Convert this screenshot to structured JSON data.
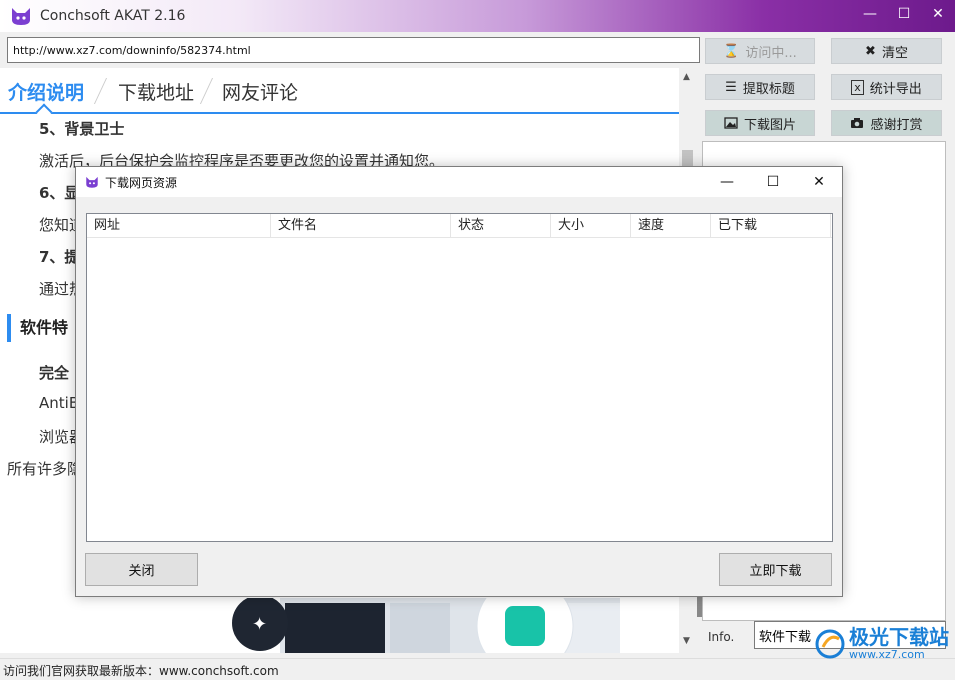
{
  "window": {
    "title": "Conchsoft AKAT 2.16"
  },
  "url_bar": {
    "value": "http://www.xz7.com/downinfo/582374.html"
  },
  "buttons": {
    "visit": "访问中...",
    "clear": "清空",
    "extract_title": "提取标题",
    "export_stats": "统计导出",
    "download_images": "下载图片",
    "donate": "感谢打赏"
  },
  "tabs": [
    {
      "label": "介绍说明",
      "active": true
    },
    {
      "label": "下载地址",
      "active": false
    },
    {
      "label": "网友评论",
      "active": false
    }
  ],
  "content": {
    "lines": [
      "5、背景卫士",
      "激活后，后台保护会监控程序是否要更改您的设置并通知您。",
      "6、显",
      "您知道",
      "7、提",
      "通过热",
      "软件特",
      "完全",
      "AntiB",
      "浏览器",
      "所有许多隐"
    ]
  },
  "info": {
    "label": "Info.",
    "value": "软件下载"
  },
  "statusbar": {
    "text": "访问我们官网获取最新版本：www.conchsoft.com"
  },
  "watermark": {
    "brand": "极光下载站",
    "site": "www.xz7.com"
  },
  "dialog": {
    "title": "下载网页资源",
    "columns": [
      "网址",
      "文件名",
      "状态",
      "大小",
      "速度",
      "已下载"
    ],
    "close_button": "关闭",
    "download_button": "立即下载"
  },
  "colors": {
    "accent": "#2d8cf0",
    "title_purple": "#8a2fa6"
  }
}
